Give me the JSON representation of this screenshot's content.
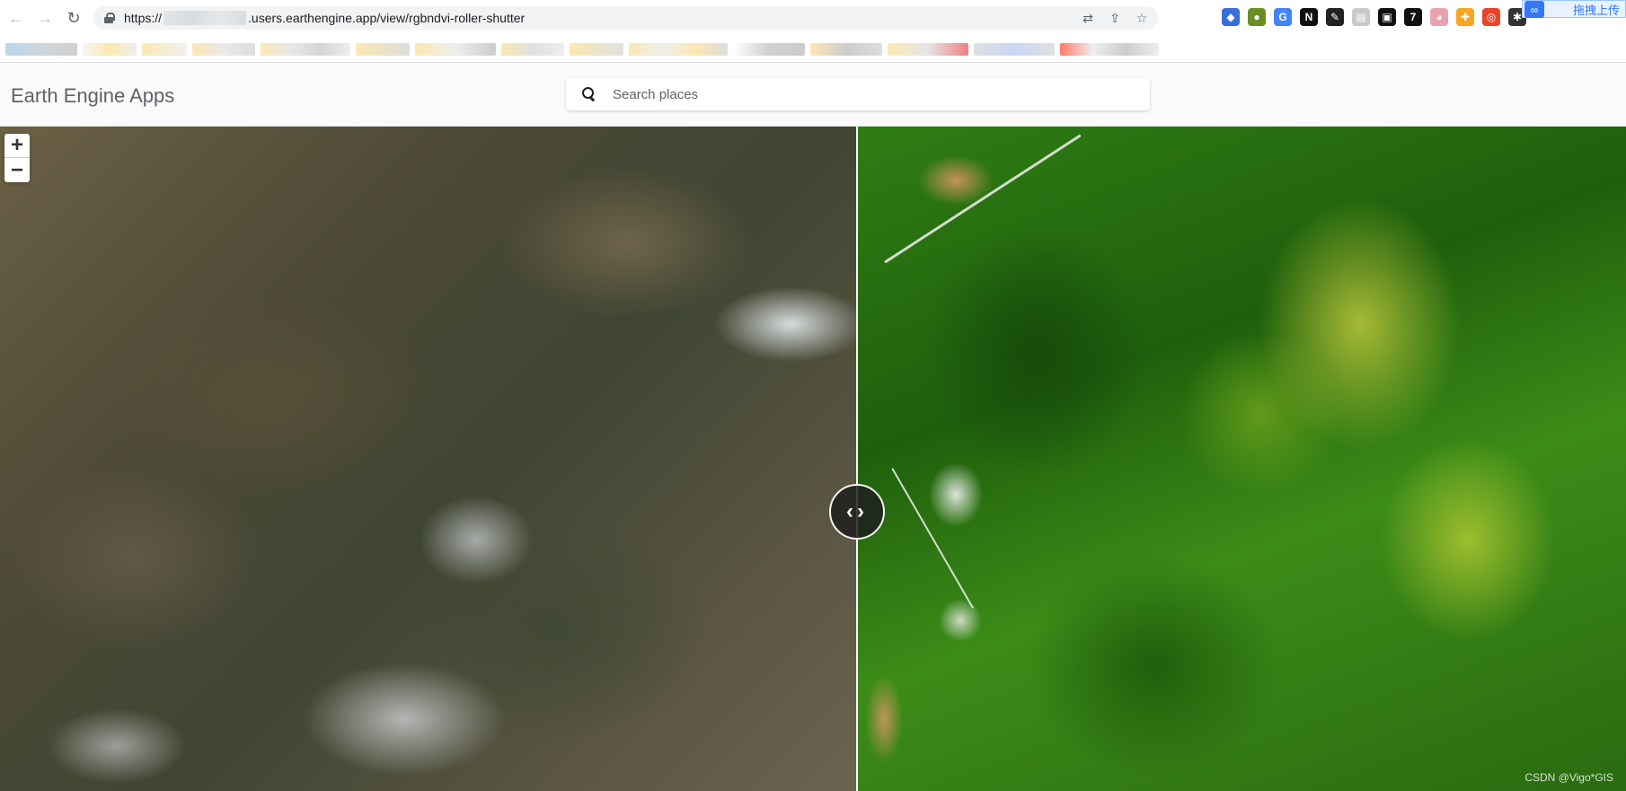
{
  "browser": {
    "url_prefix": "https://",
    "url_rest": ".users.earthengine.app/view/rgbndvi-roller-shutter",
    "upload_label": "拖拽上传"
  },
  "app": {
    "title": "Earth Engine Apps",
    "search_placeholder": "Search places"
  },
  "map": {
    "zoom_in": "+",
    "zoom_out": "−",
    "divider_glyph": "‹›",
    "watermark": "CSDN @Vigo*GIS"
  },
  "colors": {
    "accent": "#3478f6"
  }
}
